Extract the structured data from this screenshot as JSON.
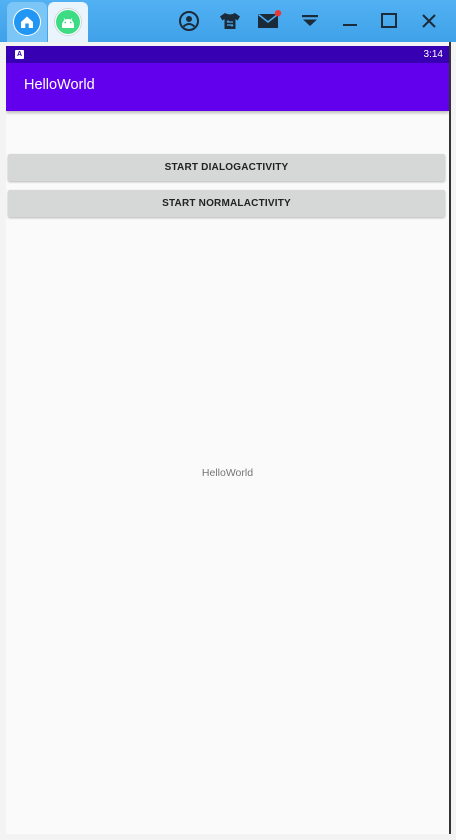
{
  "emulator": {
    "tabs": [
      {
        "icon": "home-icon"
      },
      {
        "icon": "android-icon"
      }
    ],
    "toolbar_icons": [
      "account-icon",
      "tshirt-icon",
      "mail-icon",
      "dropdown-icon",
      "minimize-icon",
      "maximize-icon",
      "close-icon"
    ],
    "mail_badge_color": "#e53935"
  },
  "status_bar": {
    "indicator": "A",
    "time": "3:14"
  },
  "app_bar": {
    "title": "HelloWorld"
  },
  "buttons": {
    "dialog_activity": "START DIALOGACTIVITY",
    "normal_activity": "START NORMALACTIVITY"
  },
  "content": {
    "center_text": "HelloWorld"
  },
  "colors": {
    "primary": "#6200ee",
    "primary_dark": "#3700b3",
    "toolbar": "#49aaf0"
  }
}
